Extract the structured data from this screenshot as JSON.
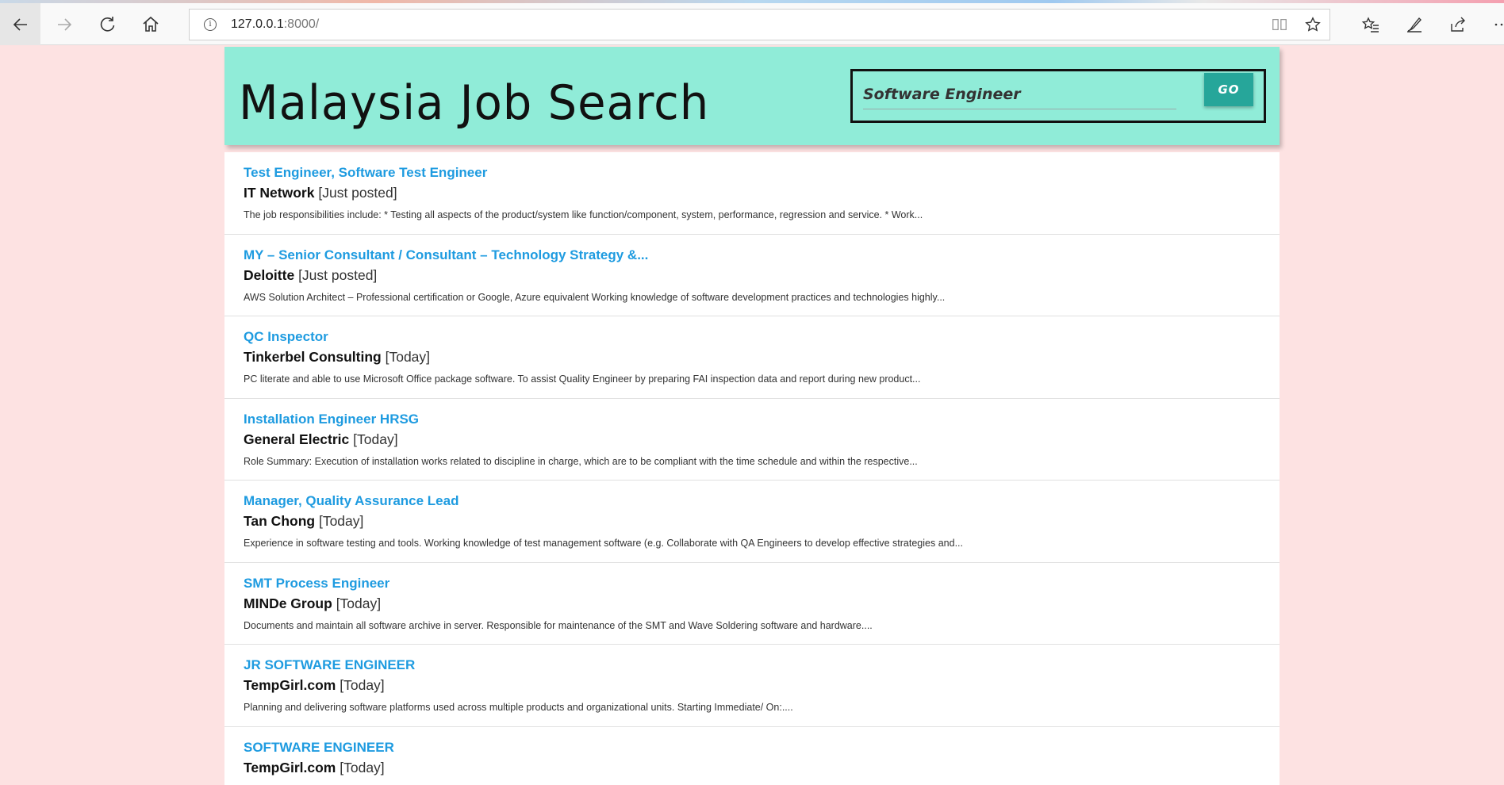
{
  "browser": {
    "url_host": "127.0.0.1",
    "url_rest": ":8000/"
  },
  "header": {
    "site_title": "Malaysia Job Search",
    "search_value": "Software Engineer",
    "go_label": "GO"
  },
  "jobs": [
    {
      "title": "Test Engineer, Software Test Engineer",
      "company": "IT Network",
      "posted": "[Just posted]",
      "description": "The job responsibilities include: * Testing all aspects of the product/system like function/component, system, performance, regression and service. * Work..."
    },
    {
      "title": "MY – Senior Consultant / Consultant – Technology Strategy &...",
      "company": "Deloitte",
      "posted": "[Just posted]",
      "description": "AWS Solution Architect – Professional certification or Google, Azure equivalent Working knowledge of software development practices and technologies highly..."
    },
    {
      "title": "QC Inspector",
      "company": "Tinkerbel Consulting",
      "posted": "[Today]",
      "description": "PC literate and able to use Microsoft Office package software. To assist Quality Engineer by preparing FAI inspection data and report during new product..."
    },
    {
      "title": "Installation Engineer HRSG",
      "company": "General Electric",
      "posted": "[Today]",
      "description": "Role Summary: Execution of installation works related to discipline in charge, which are to be compliant with the time schedule and within the respective..."
    },
    {
      "title": "Manager, Quality Assurance Lead",
      "company": "Tan Chong",
      "posted": "[Today]",
      "description": "Experience in software testing and tools. Working knowledge of test management software (e.g. Collaborate with QA Engineers to develop effective strategies and..."
    },
    {
      "title": "SMT Process Engineer",
      "company": "MINDe Group",
      "posted": "[Today]",
      "description": "Documents and maintain all software archive in server. Responsible for maintenance of the SMT and Wave Soldering software and hardware...."
    },
    {
      "title": "JR SOFTWARE ENGINEER",
      "company": "TempGirl.com",
      "posted": "[Today]",
      "description": " Planning and delivering software platforms used across multiple products and organizational units. Starting Immediate/ On:...."
    },
    {
      "title": "SOFTWARE ENGINEER",
      "company": "TempGirl.com",
      "posted": "[Today]",
      "description": ""
    }
  ],
  "colors": {
    "page_background": "#fde2e2",
    "header_background": "#90ecd8",
    "link": "#1e9be0",
    "go_button": "#26a69a"
  }
}
